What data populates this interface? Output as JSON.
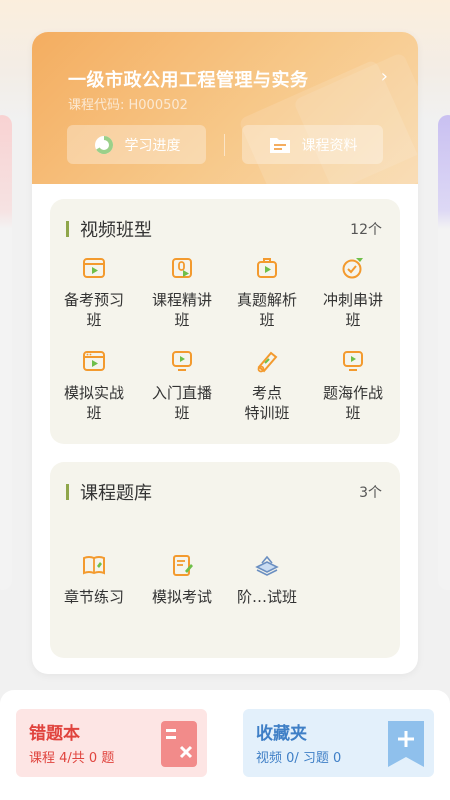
{
  "course": {
    "title": "一级市政公用工程管理与实务",
    "code": "课程代码: H000502",
    "progress_label": "学习进度",
    "materials_label": "课程资料"
  },
  "video_section": {
    "title": "视频班型",
    "count": "12个",
    "items": [
      {
        "line1": "备考预习",
        "line2": "班",
        "icon": "play-screen-icon"
      },
      {
        "line1": "课程精讲",
        "line2": "班",
        "icon": "microphone-play-icon"
      },
      {
        "line1": "真题解析",
        "line2": "班",
        "icon": "briefcase-play-icon"
      },
      {
        "line1": "冲刺串讲",
        "line2": "班",
        "icon": "sprint-target-icon"
      },
      {
        "line1": "模拟实战",
        "line2": "班",
        "icon": "browser-play-icon"
      },
      {
        "line1": "入门直播",
        "line2": "班",
        "icon": "monitor-play-icon"
      },
      {
        "line1": "考点",
        "line2": "特训班",
        "icon": "scroll-icon"
      },
      {
        "line1": "题海作战",
        "line2": "班",
        "icon": "tv-play-icon"
      }
    ]
  },
  "bank_section": {
    "title": "课程题库",
    "count": "3个",
    "items": [
      {
        "label": "章节练习",
        "icon": "open-book-icon"
      },
      {
        "label": "模拟考试",
        "icon": "exam-paper-icon"
      },
      {
        "label": "阶…试班",
        "icon": "book-stack-icon"
      }
    ]
  },
  "wrong_book": {
    "title": "错题本",
    "subtitle": "课程 4/共 0 题",
    "color": "#e0443e"
  },
  "favorites": {
    "title": "收藏夹",
    "subtitle": "视频 0/ 习题 0",
    "color": "#3f7fc6"
  },
  "colors": {
    "header_orange": "#f4ad60",
    "icon_orange": "#f39a2e",
    "icon_green": "#6fbf4a",
    "section_bg": "#f5f4ec"
  }
}
